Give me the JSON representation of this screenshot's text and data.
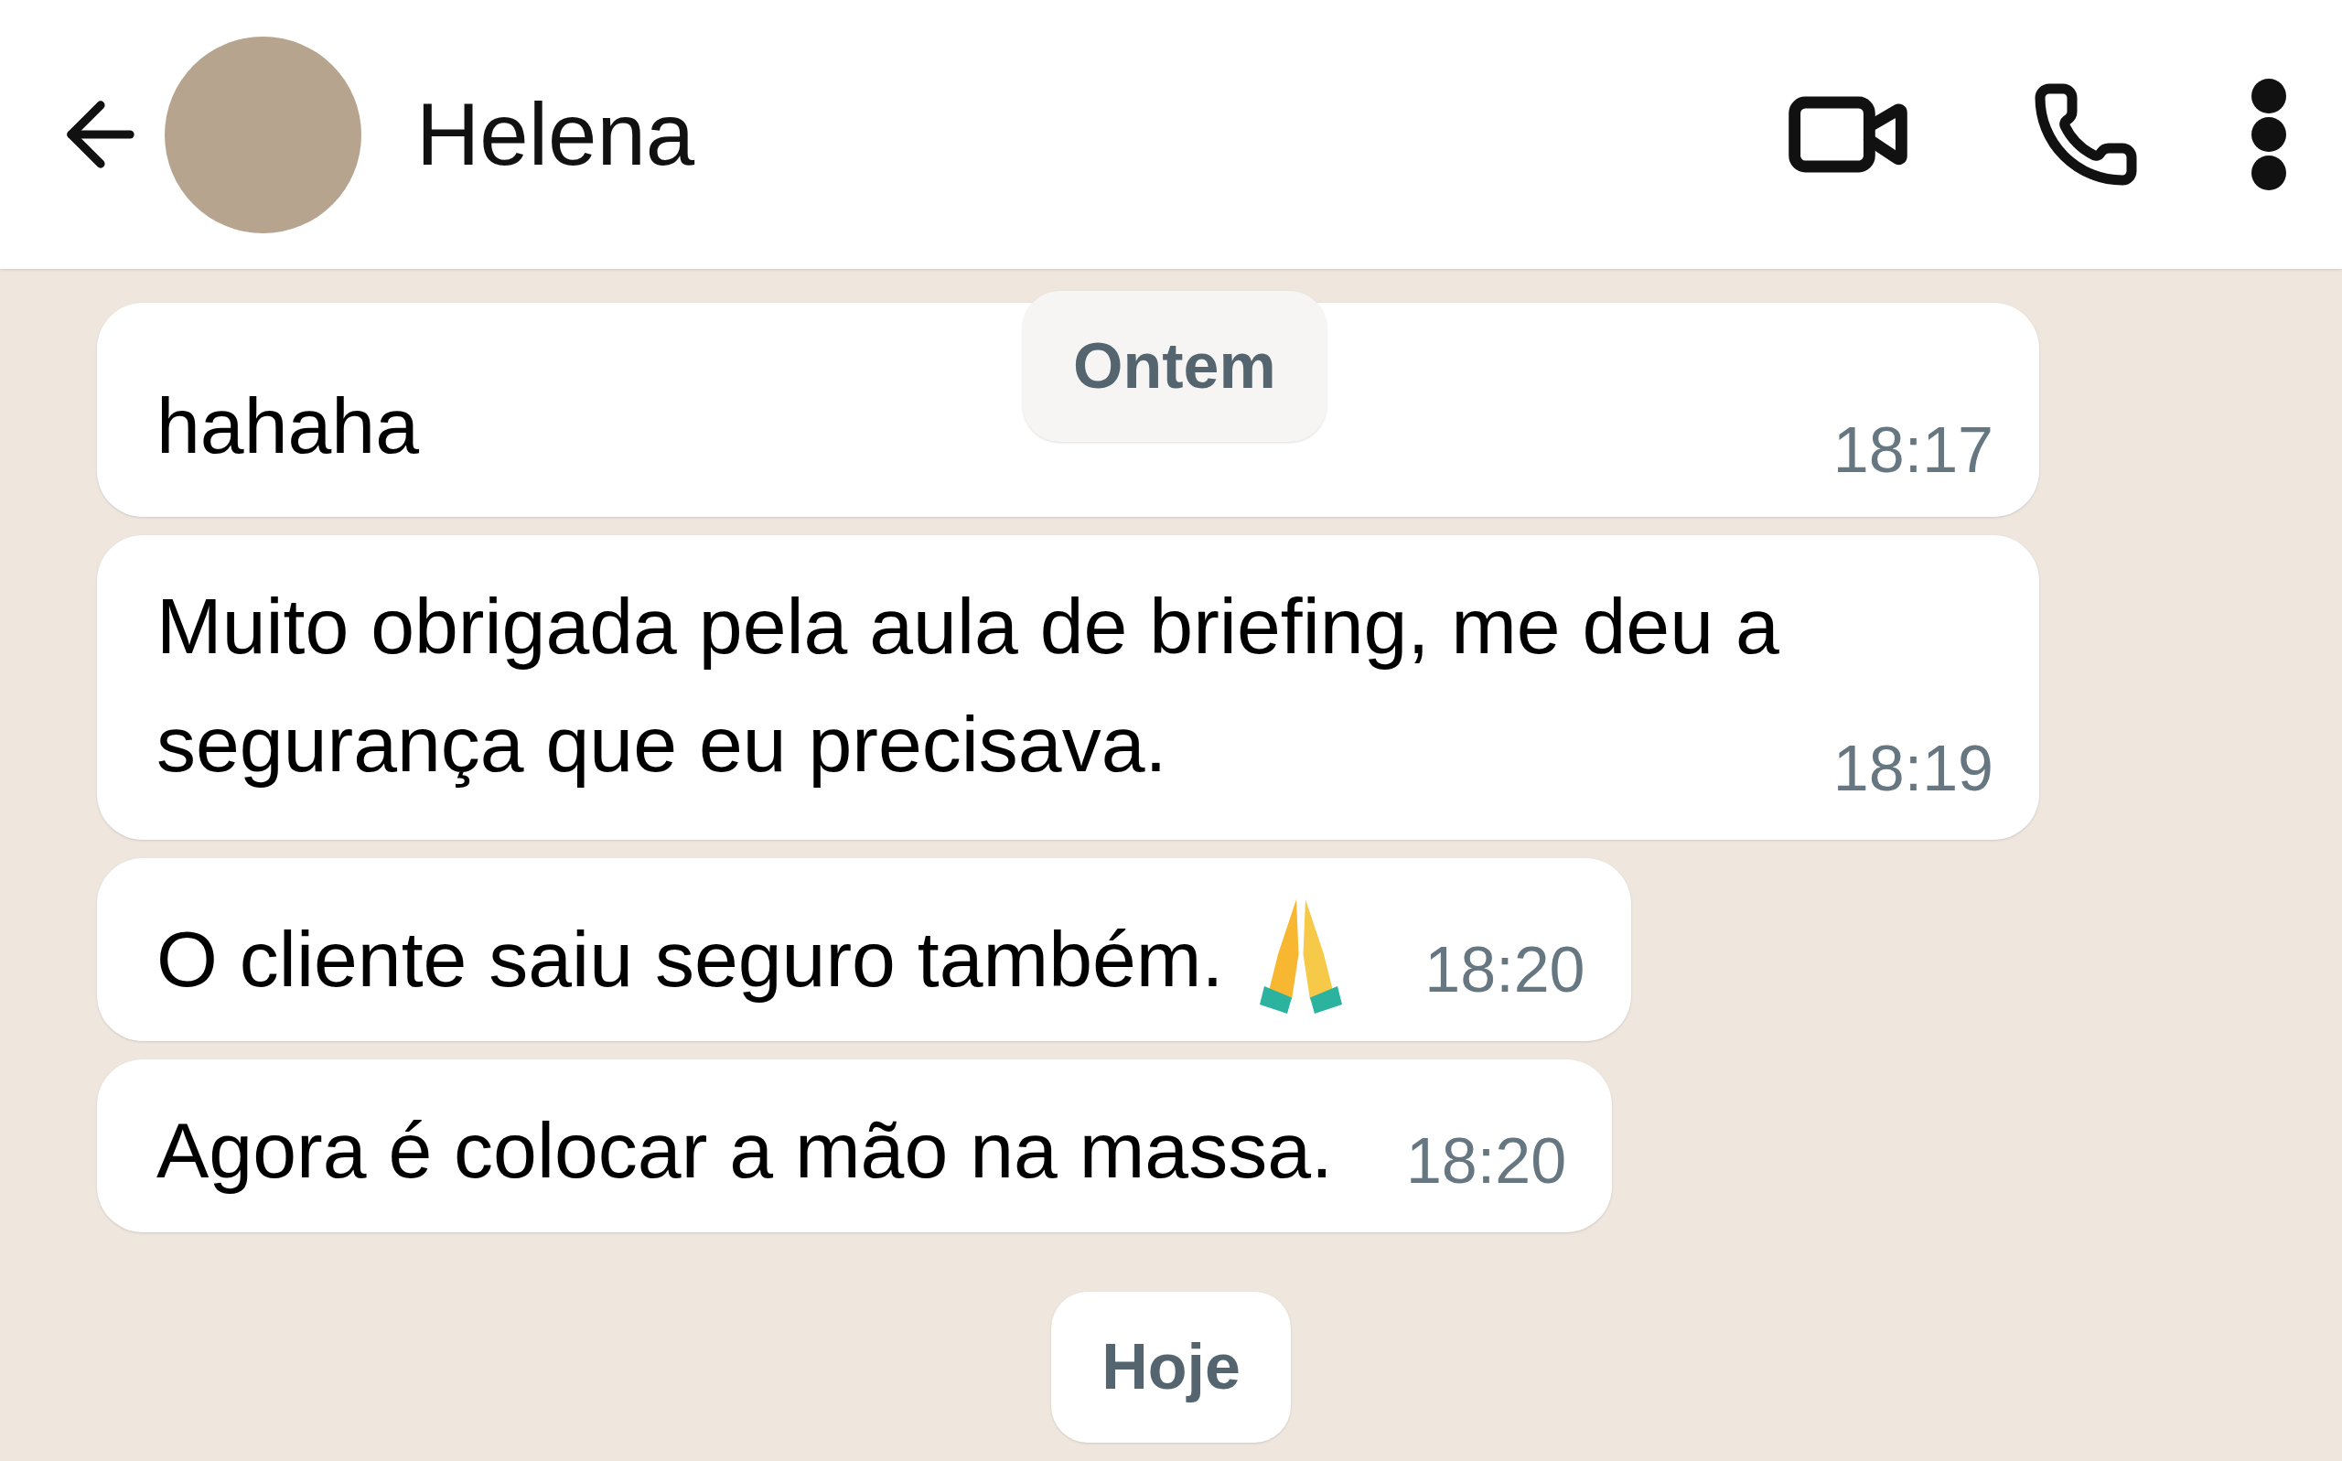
{
  "header": {
    "contact_name": "Helena"
  },
  "sticky_date": "Ontem",
  "messages": [
    {
      "kind": "plain",
      "text": "hahaha",
      "time": "18:17",
      "wide": true
    },
    {
      "kind": "plain",
      "text": "Muito obrigada pela aula de briefing, me deu a segurança que eu precisava.",
      "time": "18:19",
      "wide": true
    },
    {
      "kind": "with-emoji",
      "text": "O cliente saiu seguro também.",
      "time": "18:20",
      "wide": false
    },
    {
      "kind": "plain",
      "text": "Agora é colocar a mão na massa.",
      "time": "18:20",
      "wide": false
    }
  ],
  "date_divider": "Hoje"
}
